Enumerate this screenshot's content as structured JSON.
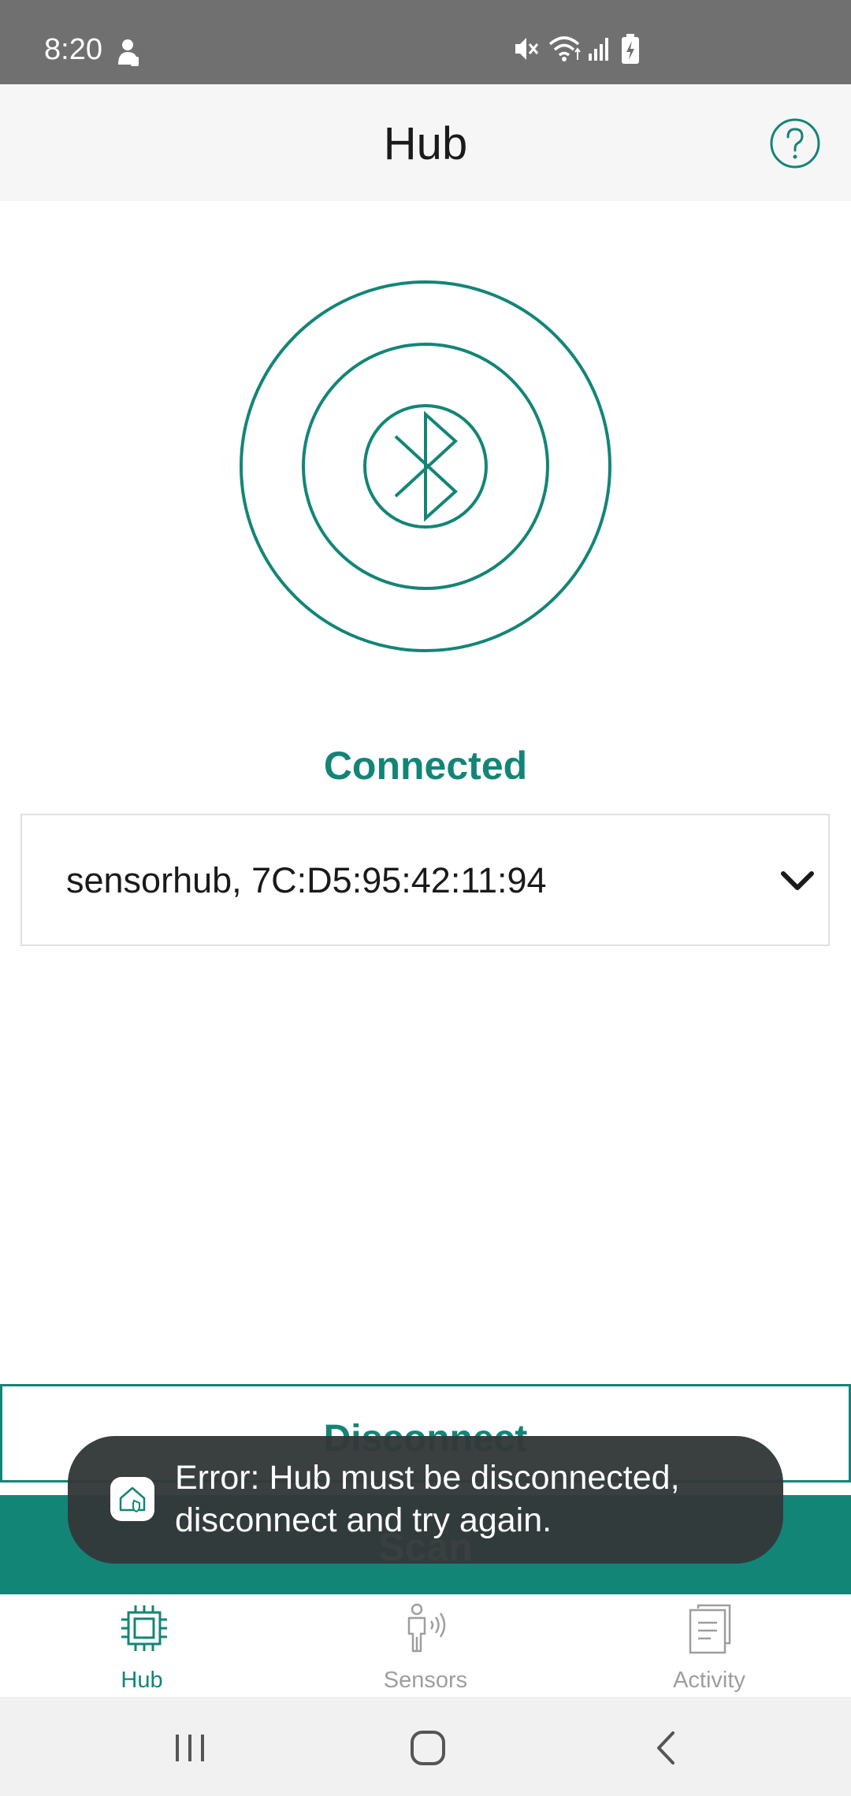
{
  "status_bar": {
    "time": "8:20",
    "icons": [
      "android-head-icon",
      "mute-icon",
      "wifi-icon",
      "signal-icon",
      "battery-charging-icon"
    ]
  },
  "header": {
    "title": "Hub",
    "help_icon": "help-circle-icon"
  },
  "hub": {
    "status": "Connected",
    "device": "sensorhub, 7C:D5:95:42:11:94",
    "graphic_icon": "bluetooth-icon"
  },
  "buttons": {
    "disconnect": "Disconnect",
    "scan": "Scan"
  },
  "toast": {
    "message": "Error: Hub must be disconnected, disconnect and try again."
  },
  "bottom_nav": {
    "items": [
      {
        "label": "Hub",
        "icon": "chip-icon",
        "active": true
      },
      {
        "label": "Sensors",
        "icon": "person-sensor-icon",
        "active": false
      },
      {
        "label": "Activity",
        "icon": "document-icon",
        "active": false
      }
    ]
  },
  "colors": {
    "accent": "#138577",
    "status_bar": "#707070",
    "app_bar": "#f6f6f6",
    "toast": "#34393a",
    "inactive": "#9e9e9e"
  }
}
